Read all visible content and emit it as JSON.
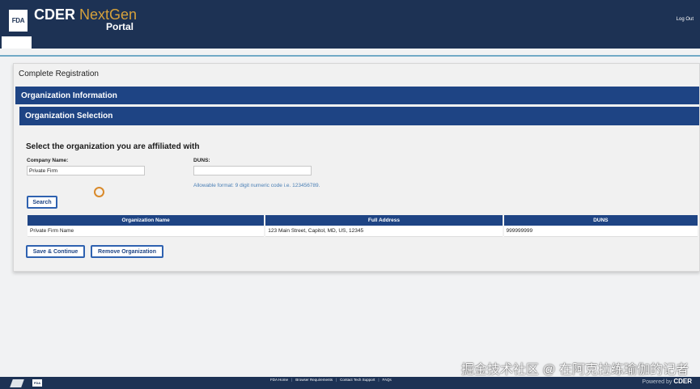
{
  "header": {
    "logo_text": "FDA",
    "brand_cder": "CDER",
    "brand_nextgen": "NextGen",
    "brand_portal": "Portal",
    "logout": "Log Out"
  },
  "page": {
    "title": "Complete Registration",
    "section_org_info": "Organization Information",
    "section_org_selection": "Organization Selection",
    "select_heading": "Select the organization you are affiliated with"
  },
  "form": {
    "company_label": "Company Name:",
    "company_value": "Private Firm",
    "duns_label": "DUNS:",
    "duns_value": "",
    "duns_hint": "Allowable format: 9 digit numeric code i.e. 123456789.",
    "search_button": "Search"
  },
  "table": {
    "headers": [
      "Organization Name",
      "Full Address",
      "DUNS"
    ],
    "rows": [
      [
        "Private Firm Name",
        "123 Main Street, Capitol, MD, US, 12345",
        "999999999"
      ]
    ]
  },
  "actions": {
    "save_continue": "Save & Continue",
    "remove_org": "Remove Organization"
  },
  "footer": {
    "fda_logo": "FDA",
    "links": [
      "FDA Home",
      "Browser Requirements",
      "Contact Tech Support",
      "FAQs"
    ],
    "powered_prefix": "Powered by",
    "powered_brand": "CDER"
  },
  "watermark": "掘金技术社区 @ 在阿克拉练瑜伽的记者",
  "colors": {
    "header_bg": "#1d3254",
    "section_bar": "#1e4484",
    "button_border": "#2f62b0",
    "accent_gold": "#d6a13b",
    "hint_blue": "#4a7fb5"
  }
}
